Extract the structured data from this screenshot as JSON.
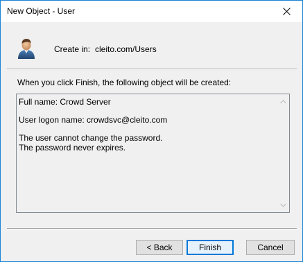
{
  "window": {
    "title": "New Object - User",
    "accent_color": "#1883d7"
  },
  "titlebar": {
    "close_icon": "close-icon"
  },
  "header": {
    "icon": "user-icon",
    "create_in_label": "Create in:",
    "create_in_value": "cleito.com/Users"
  },
  "main": {
    "intro_text": "When you click Finish, the following object will be created:",
    "summary": {
      "full_name": "Full name: Crowd Server",
      "logon_name": "User logon name: crowdsvc@cleito.com",
      "password_note_1": "The user cannot change the password.",
      "password_note_2": "The password never expires."
    }
  },
  "buttons": {
    "back": "< Back",
    "finish": "Finish",
    "cancel": "Cancel",
    "default_button_color": "#0078d7"
  }
}
